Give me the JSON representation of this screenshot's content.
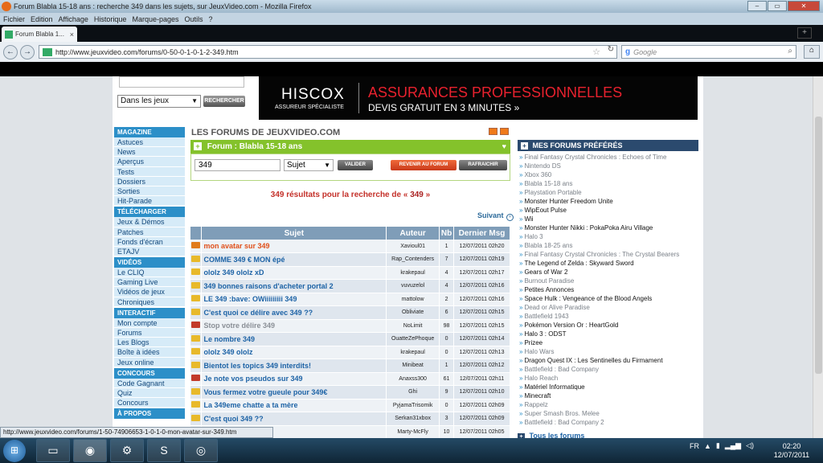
{
  "window": {
    "title": "Forum Blabla 15-18 ans : recherche 349 dans les sujets, sur JeuxVideo.com - Mozilla Firefox",
    "btn_min": "–",
    "btn_max": "▭",
    "btn_close": "✕"
  },
  "menu": [
    "Fichier",
    "Edition",
    "Affichage",
    "Historique",
    "Marque-pages",
    "Outils",
    "?"
  ],
  "tab": {
    "label": "Forum Blabla 1...",
    "close": "×",
    "new": "+"
  },
  "nav": {
    "back": "←",
    "forward": "→",
    "url": "http://www.jeuxvideo.com/forums/0-50-0-1-0-1-2-349.htm",
    "reload": "↻",
    "search_placeholder": "Google",
    "search_g": "g"
  },
  "site": {
    "search_select": "Dans les jeux",
    "search_button": "RECHERCHER",
    "banner": {
      "brand": "HISCOX",
      "brand_sub": "ASSUREUR SPÉCIALISTE",
      "line1": "ASSURANCES PROFESSIONNELLES",
      "line2": "DEVIS GRATUIT EN 3 MINUTES »"
    },
    "forums_title": "LES FORUMS DE JEUXVIDEO.COM",
    "forum_label": "Forum :",
    "forum_name": "Blabla 15-18 ans",
    "query": "349",
    "scope": "Sujet",
    "btn_valider": "VALIDER",
    "btn_revenir": "REVENIR AU FORUM",
    "btn_rafraichir": "RAFRAICHIR",
    "results_prefix": "349 résultats pour la recherche de «",
    "results_query": "349",
    "results_suffix": "»",
    "suivant": "Suivant",
    "table": {
      "headers": [
        "Sujet",
        "Auteur",
        "Nb",
        "Dernier Msg"
      ],
      "rows": [
        {
          "subject": "mon avatar sur 349",
          "author": "Xavioul01",
          "nb": "1",
          "date": "12/07/2011 02h20",
          "color": "#e07b1a",
          "subj_color": "#e0501a"
        },
        {
          "subject": "COMME 349 € MON épé",
          "author": "Rap_Contenders",
          "nb": "7",
          "date": "12/07/2011 02h19",
          "color": "#e8b92a",
          "subj_color": "#1d63a6"
        },
        {
          "subject": "ololz 349 ololz xD",
          "author": "krakepaul",
          "nb": "4",
          "date": "12/07/2011 02h17",
          "color": "#e8b92a",
          "subj_color": "#1d63a6"
        },
        {
          "subject": "349 bonnes raisons d'acheter portal 2",
          "author": "vuvuzelol",
          "nb": "4",
          "date": "12/07/2011 02h16",
          "color": "#e8b92a",
          "subj_color": "#1d63a6"
        },
        {
          "subject": "LE 349 :bave: OWiiiiiiiii 349",
          "author": "mattolow",
          "nb": "2",
          "date": "12/07/2011 02h16",
          "color": "#e8b92a",
          "subj_color": "#1d63a6"
        },
        {
          "subject": "C'est quoi ce délire avec 349 ??",
          "author": "Obliviate",
          "nb": "6",
          "date": "12/07/2011 02h15",
          "color": "#e8b92a",
          "subj_color": "#1d63a6"
        },
        {
          "subject": "Stop votre délire 349",
          "author": "NoLimit",
          "nb": "98",
          "date": "12/07/2011 02h15",
          "color": "#c23a2a",
          "subj_color": "#8a8f96"
        },
        {
          "subject": "Le nombre 349",
          "author": "OuatteZePhoque",
          "nb": "0",
          "date": "12/07/2011 02h14",
          "color": "#e8b92a",
          "subj_color": "#1d63a6"
        },
        {
          "subject": "ololz 349 ololz",
          "author": "krakepaul",
          "nb": "0",
          "date": "12/07/2011 02h13",
          "color": "#e8b92a",
          "subj_color": "#1d63a6"
        },
        {
          "subject": "Bientot les topics 349 interdits!",
          "author": "Minibeat",
          "nb": "1",
          "date": "12/07/2011 02h12",
          "color": "#e8b92a",
          "subj_color": "#1d63a6"
        },
        {
          "subject": "Je note vos pseudos sur 349",
          "author": "Anaxss300",
          "nb": "61",
          "date": "12/07/2011 02h11",
          "color": "#c23a2a",
          "subj_color": "#1d63a6"
        },
        {
          "subject": "Vous fermez votre gueule pour 349€",
          "author": "Ghi",
          "nb": "9",
          "date": "12/07/2011 02h10",
          "color": "#e8b92a",
          "subj_color": "#1d63a6"
        },
        {
          "subject": "La 349eme chatte a ta mère",
          "author": "PyjamaTrisomik",
          "nb": "0",
          "date": "12/07/2011 02h09",
          "color": "#e8b92a",
          "subj_color": "#1d63a6"
        },
        {
          "subject": "C'est quoi 349 ??",
          "author": "Serkan31xbox",
          "nb": "3",
          "date": "12/07/2011 02h09",
          "color": "#e8b92a",
          "subj_color": "#1d63a6"
        },
        {
          "subject": "5-18*",
          "author": "Marty-McFly",
          "nb": "10",
          "date": "12/07/2011 02h05",
          "color": "#e8b92a",
          "subj_color": "#1d63a6"
        }
      ]
    },
    "leftnav": [
      {
        "head": "MAGAZINE",
        "items": [
          "Astuces",
          "News",
          "Aperçus",
          "Tests",
          "Dossiers",
          "Sorties",
          "Hit-Parade"
        ]
      },
      {
        "head": "TÉLÉCHARGER",
        "items": [
          "Jeux & Démos",
          "Patches",
          "Fonds d'écran",
          "ETAJV"
        ]
      },
      {
        "head": "VIDÉOS",
        "items": [
          "Le CLIQ",
          "Gaming Live",
          "Vidéos de jeux",
          "Chroniques"
        ]
      },
      {
        "head": "INTERACTIF",
        "items": [
          "Mon compte",
          "Forums",
          "Les Blogs",
          "Boîte à idées",
          "Jeux online"
        ]
      },
      {
        "head": "CONCOURS",
        "items": [
          "Code Gagnant",
          "Quiz",
          "Concours"
        ]
      },
      {
        "head": "À PROPOS",
        "items": []
      }
    ],
    "favorites_title": "MES FORUMS PRÉFÉRÉS",
    "favorites": [
      {
        "t": "Final Fantasy Crystal Chronicles : Echoes of Time",
        "dim": true
      },
      {
        "t": "Nintendo DS",
        "dim": true
      },
      {
        "t": "Xbox 360",
        "dim": true
      },
      {
        "t": "Blabla 15-18 ans",
        "dim": true
      },
      {
        "t": "Playstation Portable",
        "dim": true
      },
      {
        "t": "Monster Hunter Freedom Unite",
        "dim": false
      },
      {
        "t": "WipEout Pulse",
        "dim": false
      },
      {
        "t": "Wii",
        "dim": false
      },
      {
        "t": "Monster Hunter Nikki : PokaPoka Airu Village",
        "dim": false
      },
      {
        "t": "Halo 3",
        "dim": true
      },
      {
        "t": "Blabla 18-25 ans",
        "dim": true
      },
      {
        "t": "Final Fantasy Crystal Chronicles : The Crystal Bearers",
        "dim": true
      },
      {
        "t": "The Legend of Zelda : Skyward Sword",
        "dim": false
      },
      {
        "t": "Gears of War 2",
        "dim": false
      },
      {
        "t": "Burnout Paradise",
        "dim": true
      },
      {
        "t": "Petites Annonces",
        "dim": false
      },
      {
        "t": "Space Hulk : Vengeance of the Blood Angels",
        "dim": false
      },
      {
        "t": "Dead or Alive Paradise",
        "dim": true
      },
      {
        "t": "Battlefield 1943",
        "dim": true
      },
      {
        "t": "Pokémon Version Or : HeartGold",
        "dim": false
      },
      {
        "t": "Halo 3 : ODST",
        "dim": false
      },
      {
        "t": "Prizee",
        "dim": false
      },
      {
        "t": "Halo Wars",
        "dim": true
      },
      {
        "t": "Dragon Quest IX : Les Sentinelles du Firmament",
        "dim": false
      },
      {
        "t": "Battlefield : Bad Company",
        "dim": true
      },
      {
        "t": "Halo Reach",
        "dim": true
      },
      {
        "t": "Matériel Informatique",
        "dim": false
      },
      {
        "t": "Minecraft",
        "dim": false
      },
      {
        "t": "Rappelz",
        "dim": true
      },
      {
        "t": "Super Smash Bros. Melee",
        "dim": true
      },
      {
        "t": "Battlefield : Bad Company 2",
        "dim": true
      }
    ],
    "tous_les_forums": "Tous les forums"
  },
  "status_url": "http://www.jeuxvideo.com/forums/1-50-74906653-1-0-1-0-mon-avatar-sur-349.htm",
  "taskbar": {
    "lang": "FR",
    "time": "02:20",
    "date": "12/07/2011"
  },
  "colors": {
    "accent_green": "#84c22b",
    "nav_blue": "#2c8fc8",
    "fav_head": "#2b4a6e",
    "table_head": "#7f9db8"
  }
}
